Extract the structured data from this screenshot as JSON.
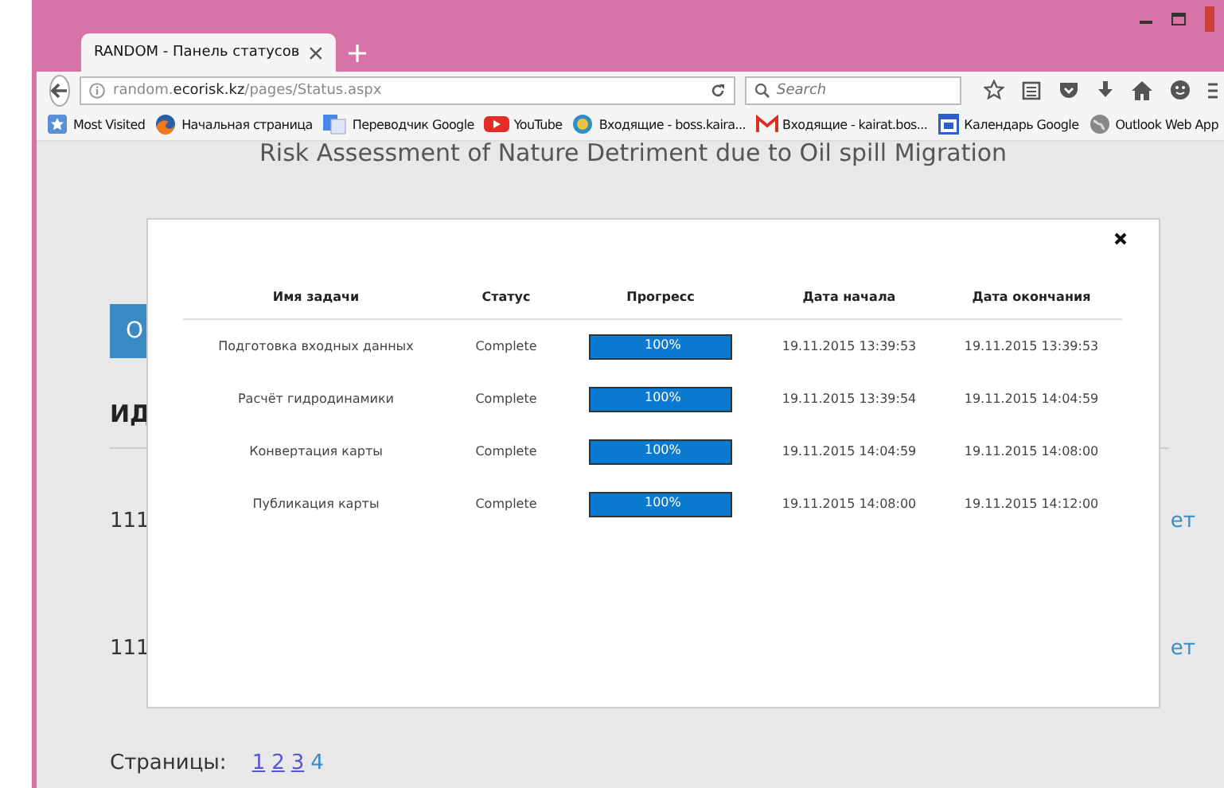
{
  "tabs": [
    {
      "title": "RANDOM - Панель статусов",
      "selected": true
    }
  ],
  "address": {
    "prefix": "random.",
    "domain": "ecorisk.kz",
    "path": "/pages/Status.aspx"
  },
  "search": {
    "placeholder": "Search"
  },
  "bookmarks": [
    {
      "label": "Most Visited",
      "kind": "star"
    },
    {
      "label": "Начальная страница",
      "kind": "firefox"
    },
    {
      "label": "Переводчик Google",
      "kind": "translate"
    },
    {
      "label": "YouTube",
      "kind": "youtube"
    },
    {
      "label": "Входящие - boss.kaira...",
      "kind": "mail"
    },
    {
      "label": "Входящие - kairat.bos...",
      "kind": "gmail"
    },
    {
      "label": "Календарь Google",
      "kind": "calendar"
    },
    {
      "label": "Outlook Web App",
      "kind": "globe"
    }
  ],
  "page": {
    "title": "Risk Assessment of Nature Detriment due to Oil spill Migration",
    "button": "О",
    "heading": "ИД",
    "rows": [
      {
        "id": "111",
        "link": "ет"
      },
      {
        "id": "111",
        "link": "ет"
      }
    ],
    "pager_label": "Страницы:",
    "pages": [
      {
        "label": "1",
        "selected": false
      },
      {
        "label": "2",
        "selected": false
      },
      {
        "label": "3",
        "selected": false
      },
      {
        "label": "4",
        "selected": true
      }
    ]
  },
  "modal": {
    "columns": [
      "Имя задачи",
      "Статус",
      "Прогресс",
      "Дата начала",
      "Дата окончания"
    ],
    "rows": [
      {
        "name": "Подготовка входных данных",
        "status": "Complete",
        "level": 1,
        "progress": "100%",
        "start": "19.11.2015 13:39:53",
        "end": "19.11.2015 13:39:53"
      },
      {
        "name": "Расчёт гидродинамики",
        "status": "Complete",
        "level": 1,
        "progress": "100%",
        "start": "19.11.2015 13:39:54",
        "end": "19.11.2015 14:04:59"
      },
      {
        "name": "Конвертация карты",
        "status": "Complete",
        "level": 1,
        "progress": "100%",
        "start": "19.11.2015 14:04:59",
        "end": "19.11.2015 14:08:00"
      },
      {
        "name": "Публикация карты",
        "status": "Complete",
        "level": 1,
        "progress": "100%",
        "start": "19.11.2015 14:08:00",
        "end": "19.11.2015 14:12:00"
      }
    ]
  }
}
